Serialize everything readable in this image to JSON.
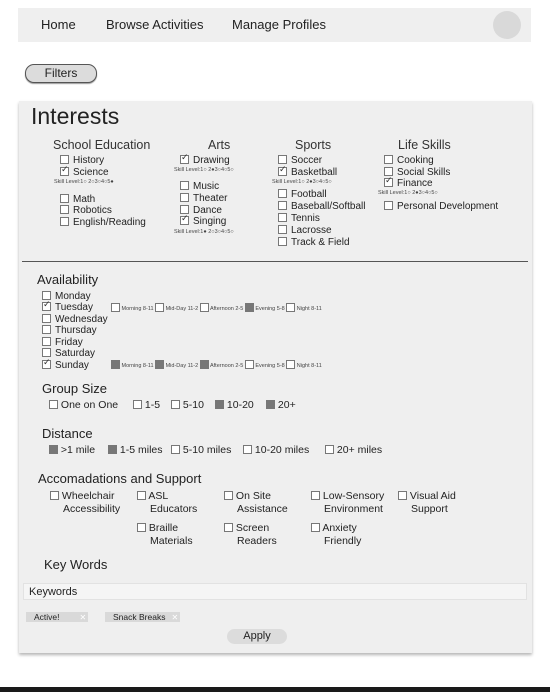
{
  "nav": {
    "links": [
      "Home",
      "Browse Activities",
      "Manage Profiles"
    ]
  },
  "filters_button": "Filters",
  "interests": {
    "title": "Interests",
    "columns": [
      {
        "heading": "School Education",
        "items": [
          {
            "label": "History",
            "checked": false
          },
          {
            "label": "Science",
            "checked": true
          },
          {
            "label": "Math",
            "checked": false
          },
          {
            "label": "Robotics",
            "checked": false
          },
          {
            "label": "English/Reading",
            "checked": false
          }
        ],
        "skill_level": "Skill Level:1○ 2○3○4○5●"
      },
      {
        "heading": "Arts",
        "items": [
          {
            "label": "Drawing",
            "checked": true
          },
          {
            "label": "Music",
            "checked": false
          },
          {
            "label": "Theater",
            "checked": false
          },
          {
            "label": "Dance",
            "checked": false
          },
          {
            "label": "Singing",
            "checked": true
          }
        ],
        "skill_level_1": "Skill Level:1○ 2●3○4○5○",
        "skill_level_2": "Skill Level:1● 2○3○4○5○"
      },
      {
        "heading": "Sports",
        "items": [
          {
            "label": "Soccer",
            "checked": false
          },
          {
            "label": "Basketball",
            "checked": true
          },
          {
            "label": "Football",
            "checked": false
          },
          {
            "label": "Baseball/Softball",
            "checked": false
          },
          {
            "label": "Tennis",
            "checked": false
          },
          {
            "label": "Lacrosse",
            "checked": false
          },
          {
            "label": "Track & Field",
            "checked": false
          }
        ],
        "skill_level": "Skill Level:1○ 2●3○4○5○"
      },
      {
        "heading": "Life Skills",
        "items": [
          {
            "label": "Cooking",
            "checked": false
          },
          {
            "label": "Social Skills",
            "checked": false
          },
          {
            "label": "Finance",
            "checked": true
          },
          {
            "label": "Personal Development",
            "checked": false
          }
        ],
        "skill_level": "Skill Level:1○ 2●3○4○5○"
      }
    ]
  },
  "availability": {
    "heading": "Availability",
    "days": [
      {
        "label": "Monday",
        "checked": false
      },
      {
        "label": "Tuesday",
        "checked": true
      },
      {
        "label": "Wednesday",
        "checked": false
      },
      {
        "label": "Thursday",
        "checked": false
      },
      {
        "label": "Friday",
        "checked": false
      },
      {
        "label": "Saturday",
        "checked": false
      },
      {
        "label": "Sunday",
        "checked": true
      }
    ],
    "tuesday_slots": [
      {
        "label": "Morning 8-11",
        "selected": false
      },
      {
        "label": "Mid-Day 11-2",
        "selected": false
      },
      {
        "label": "Afternoon 2-5",
        "selected": false
      },
      {
        "label": "Evening 5-8",
        "selected": true
      },
      {
        "label": "Night 8-11",
        "selected": false
      }
    ],
    "sunday_slots": [
      {
        "label": "Morning 8-11",
        "selected": true
      },
      {
        "label": "Mid-Day 11-2",
        "selected": true
      },
      {
        "label": "Afternoon 2-5",
        "selected": true
      },
      {
        "label": "Evening 5-8",
        "selected": false
      },
      {
        "label": "Night 8-11",
        "selected": false
      }
    ]
  },
  "group_size": {
    "heading": "Group Size",
    "options": [
      {
        "label": "One on One",
        "selected": false
      },
      {
        "label": "1-5",
        "selected": false
      },
      {
        "label": "5-10",
        "selected": false
      },
      {
        "label": "10-20",
        "selected": true
      },
      {
        "label": "20+",
        "selected": true
      }
    ]
  },
  "distance": {
    "heading": "Distance",
    "options": [
      {
        "label": ">1 mile",
        "selected": true
      },
      {
        "label": "1-5 miles",
        "selected": true
      },
      {
        "label": "5-10 miles",
        "selected": false
      },
      {
        "label": "10-20 miles",
        "selected": false
      },
      {
        "label": "20+ miles",
        "selected": false
      }
    ]
  },
  "accommodations": {
    "heading": "Accomadations and Support",
    "options": [
      {
        "line1": "Wheelchair",
        "line2": "Accessibility",
        "checked": false
      },
      {
        "line1": "ASL",
        "line2": "Educators",
        "checked": false
      },
      {
        "line1": "On Site",
        "line2": "Assistance",
        "checked": false
      },
      {
        "line1": "Low-Sensory",
        "line2": "Environment",
        "checked": false
      },
      {
        "line1": "Visual Aid",
        "line2": "Support",
        "checked": false
      },
      {
        "line1": "Braille",
        "line2": "Materials",
        "checked": false
      },
      {
        "line1": "Screen",
        "line2": "Readers",
        "checked": false
      },
      {
        "line1": "Anxiety",
        "line2": "Friendly",
        "checked": false
      }
    ]
  },
  "key_words": {
    "heading": "Key Words",
    "input_label": "Keywords",
    "chips": [
      "Active!",
      "Snack Breaks"
    ]
  },
  "apply_button": "Apply"
}
